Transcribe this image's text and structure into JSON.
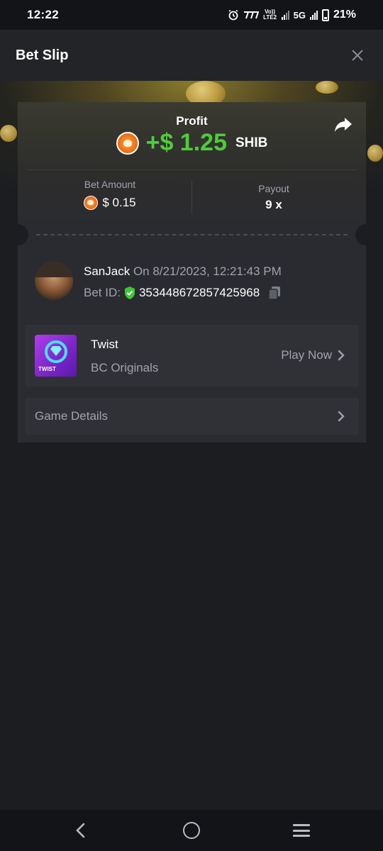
{
  "status_bar": {
    "time": "12:22",
    "carrier_small": "Vo)) LTE2",
    "network": "5G",
    "battery": "21%"
  },
  "header": {
    "title": "Bet Slip"
  },
  "profit": {
    "label": "Profit",
    "amount": "+$ 1.25",
    "currency": "SHIB",
    "amount_color": "#4fcc3a"
  },
  "stats": {
    "bet_amount_label": "Bet Amount",
    "bet_amount_value": "$ 0.15",
    "payout_label": "Payout",
    "payout_value": "9 x"
  },
  "user": {
    "name": "SanJack",
    "when": "On 8/21/2023, 12:21:43 PM",
    "bet_id_label": "Bet ID:",
    "bet_id": "353448672857425968"
  },
  "game": {
    "name": "Twist",
    "provider": "BC Originals",
    "play_label": "Play Now",
    "thumb_text": "TWIST"
  },
  "details": {
    "label": "Game Details"
  },
  "icons": {
    "close": "close-icon",
    "share": "share-icon",
    "shield": "shield-check-icon",
    "copy": "copy-icon",
    "chevron": "chevron-right-icon",
    "coin": "shib-coin-icon"
  }
}
